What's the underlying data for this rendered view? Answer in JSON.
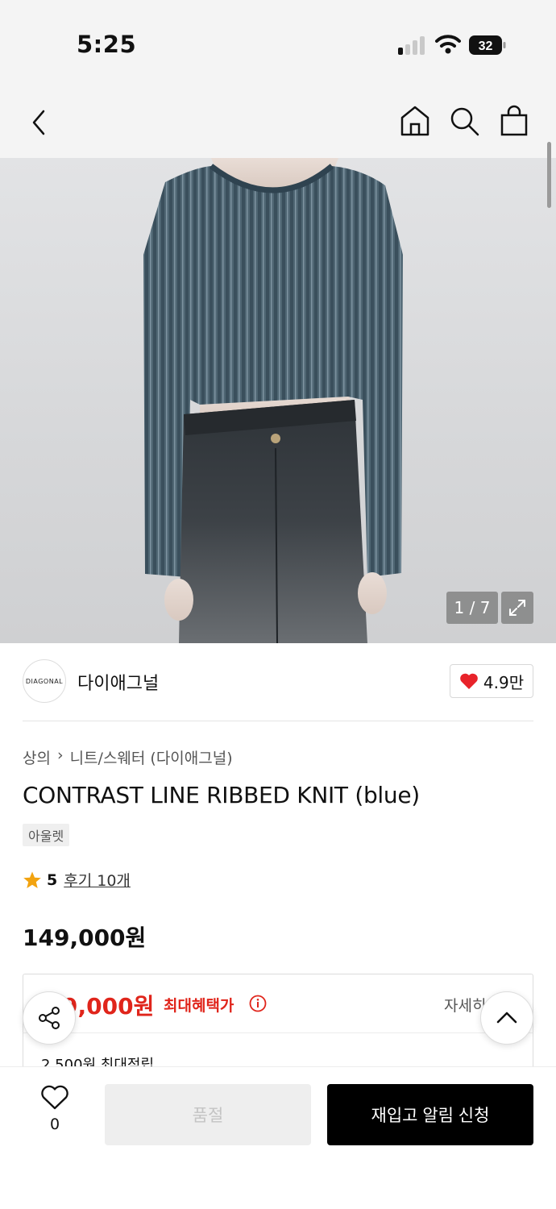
{
  "status_bar": {
    "time": "5:25",
    "battery": "32"
  },
  "nav": {
    "back_icon": "chevron-left-icon",
    "home_icon": "home-icon",
    "search_icon": "search-icon",
    "bag_icon": "shopping-bag-icon"
  },
  "gallery": {
    "counter": "1 / 7",
    "expand_icon": "expand-icon"
  },
  "brand": {
    "logo_text": "DIAGONAL",
    "name": "다이애그널",
    "likes": "4.9만",
    "heart_color": "#e8232a"
  },
  "product": {
    "breadcrumb": [
      "상의",
      "니트/스웨터 (다이애그널)"
    ],
    "title": "CONTRAST LINE RIBBED KNIT (blue)",
    "tag": "아울렛",
    "rating": "5",
    "reviews": "후기 10개",
    "price": "149,000원"
  },
  "benefit": {
    "max_price": "9,000원",
    "max_label": "최대혜택가",
    "detail": "자세히",
    "points": "2,500원 최대적립",
    "accent": "#e0251b"
  },
  "bottom_bar": {
    "wish_count": "0",
    "soldout_label": "품절",
    "restock_label": "재입고 알림 신청"
  }
}
